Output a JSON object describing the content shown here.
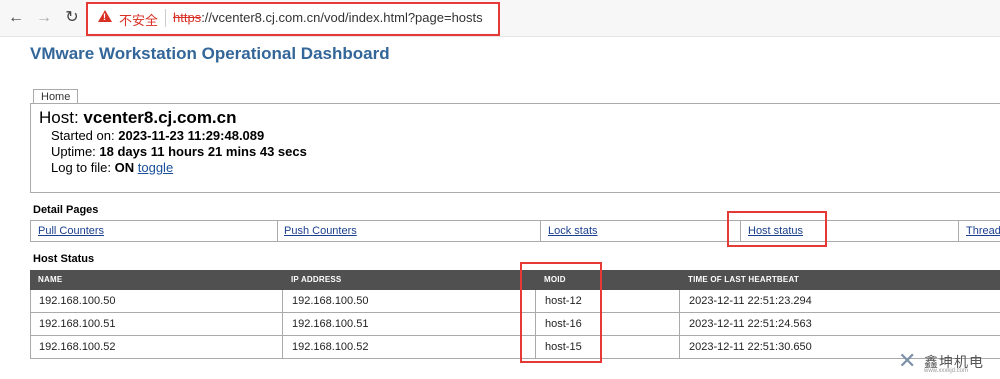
{
  "browser": {
    "back": "←",
    "forward": "→",
    "reload": "↻",
    "insecure_label": "不安全",
    "url_scheme": "https",
    "url_rest": "://vcenter8.cj.com.cn/vod/index.html?page=hosts"
  },
  "page": {
    "title": "VMware Workstation Operational Dashboard",
    "home_tab": "Home",
    "host_label": "Host:",
    "host_name": "vcenter8.cj.com.cn",
    "started_label": "Started on:",
    "started_value": "2023-11-23 11:29:48.089",
    "uptime_label": "Uptime:",
    "uptime_value": "18 days 11 hours 21 mins 43 secs",
    "log_label": "Log to file:",
    "log_value": "ON",
    "log_toggle": "toggle"
  },
  "detail_pages": {
    "heading": "Detail Pages",
    "links": [
      "Pull Counters",
      "Push Counters",
      "Lock stats",
      "Host status",
      "Thread"
    ]
  },
  "host_status": {
    "heading": "Host Status",
    "columns": [
      "NAME",
      "IP ADDRESS",
      "MOID",
      "TIME OF LAST HEARTBEAT"
    ],
    "rows": [
      [
        "192.168.100.50",
        "192.168.100.50",
        "host-12",
        "2023-12-11 22:51:23.294"
      ],
      [
        "192.168.100.51",
        "192.168.100.51",
        "host-16",
        "2023-12-11 22:51:24.563"
      ],
      [
        "192.168.100.52",
        "192.168.100.52",
        "host-15",
        "2023-12-11 22:51:30.650"
      ]
    ]
  },
  "watermark": {
    "text": "鑫坤机电",
    "sub": "www.xxxkjd.com"
  },
  "colors": {
    "title": "#336699",
    "table_header": "#505050",
    "highlight": "#e53935",
    "insecure": "#d93025"
  }
}
